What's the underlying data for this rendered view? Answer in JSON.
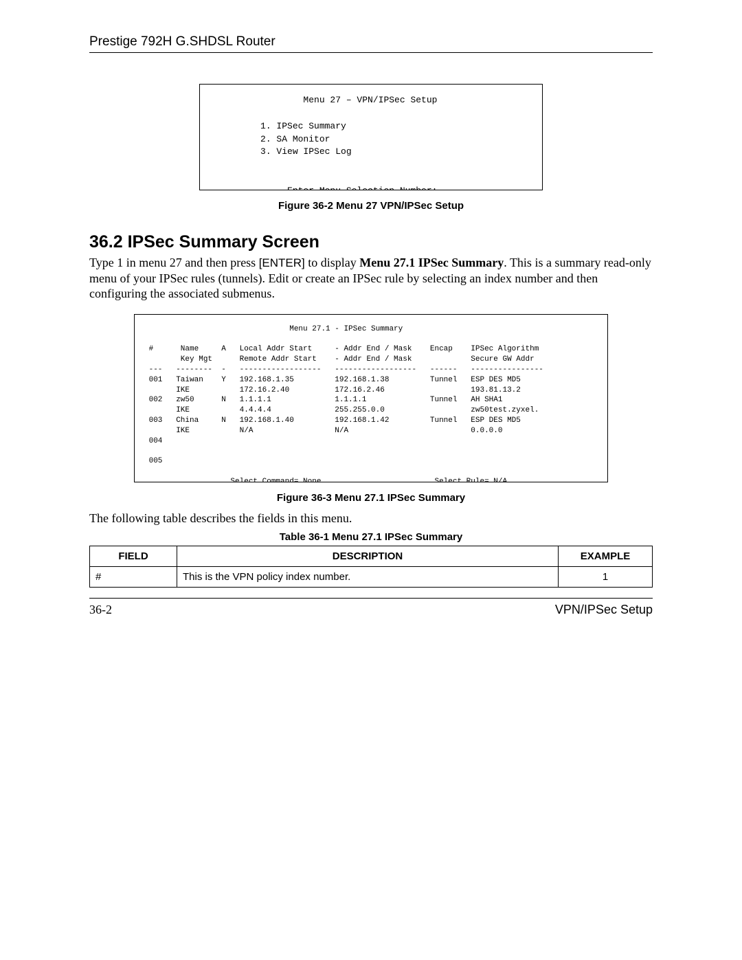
{
  "header": "Prestige 792H G.SHDSL Router",
  "terminal1": "                  Menu 27 – VPN/IPSec Setup\n\n          1. IPSec Summary\n          2. SA Monitor\n          3. View IPSec Log\n\n\n               Enter Menu Selection Number:",
  "fig1_caption": "Figure 36-2 Menu 27 VPN/IPSec Setup",
  "section_heading": "36.2  IPSec Summary Screen",
  "para_pre": "Type 1 in menu 27 and then press ",
  "para_enter": "[ENTER]",
  "para_mid": " to display ",
  "para_boldmenu": "Menu 27.1 IPSec Summary",
  "para_post": ". This is a summary read-only menu of your IPSec rules (tunnels). Edit or create an IPSec rule by selecting an index number and then configuring the associated submenus.",
  "terminal2": "                                Menu 27.1 - IPSec Summary\n\n #      Name     A   Local Addr Start     - Addr End / Mask    Encap    IPSec Algorithm\n        Key Mgt      Remote Addr Start    - Addr End / Mask             Secure GW Addr\n ---   --------  -   ------------------   ------------------   ------   ----------------\n 001   Taiwan    Y   192.168.1.35         192.168.1.38         Tunnel   ESP DES MD5\n       IKE           172.16.2.40          172.16.2.46                   193.81.13.2\n 002   zw50      N   1.1.1.1              1.1.1.1              Tunnel   AH SHA1\n       IKE           4.4.4.4              255.255.0.0                   zw50test.zyxel.\n 003   China     N   192.168.1.40         192.168.1.42         Tunnel   ESP DES MD5\n       IKE           N/A                  N/A                           0.0.0.0\n 004\n\n 005\n\n                   Select Command= None                         Select Rule= N/A\n                         Press ENTER to Confirm or ESC to Cancel:",
  "fig2_caption": "Figure 36-3 Menu 27.1 IPSec Summary",
  "table_intro": "The following table describes the fields in this menu.",
  "table_caption": "Table 36-1 Menu 27.1 IPSec Summary",
  "table": {
    "headers": [
      "FIELD",
      "DESCRIPTION",
      "EXAMPLE"
    ],
    "rows": [
      {
        "field": "#",
        "description": "This is the VPN policy index number.",
        "example": "1"
      }
    ]
  },
  "footer_left": "36-2",
  "footer_right": "VPN/IPSec Setup"
}
